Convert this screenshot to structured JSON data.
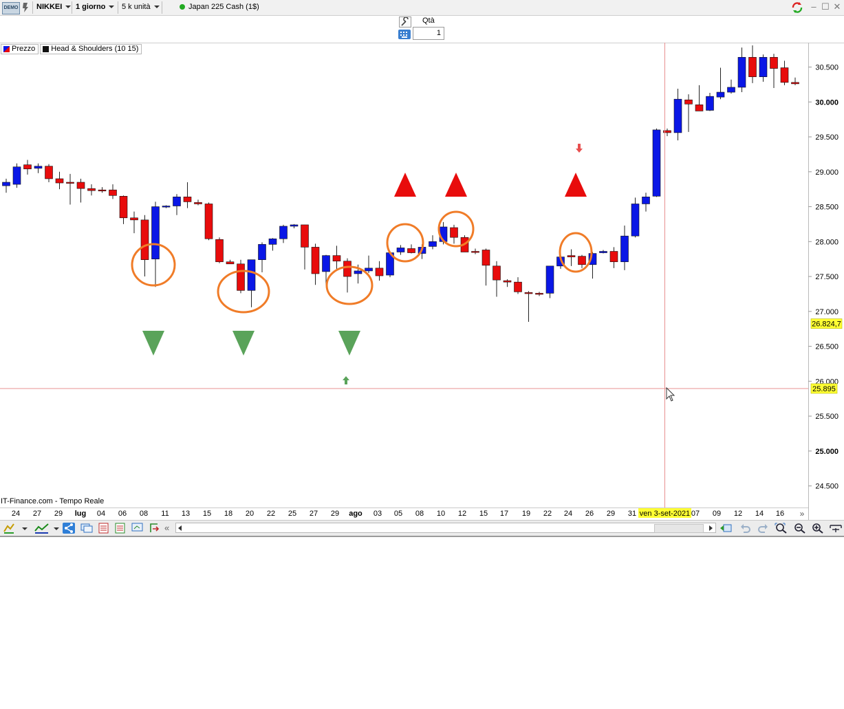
{
  "toolbar": {
    "demo_label": "DEMO",
    "instrument": "NIKKEI",
    "timeframe": "1 giorno",
    "units": "5 k unità",
    "market_name": "Japan 225 Cash (1$)",
    "status_color": "#22aa22"
  },
  "order": {
    "qty_label": "Qtà",
    "qty_value": "1"
  },
  "legend": {
    "price_label": "Prezzo",
    "indicator_label": "Head & Shoulders (10 15)"
  },
  "chart": {
    "source_label": "IT-Finance.com - Tempo Reale",
    "y_ticks": [
      "30.500",
      "30.000",
      "29.500",
      "29.000",
      "28.500",
      "28.000",
      "27.500",
      "27.000",
      "26.500",
      "26.000",
      "25.500",
      "25.000",
      "24.500"
    ],
    "y_tick_values": [
      30500,
      30000,
      29500,
      29000,
      28500,
      28000,
      27500,
      27000,
      26500,
      26000,
      25500,
      25000,
      24500
    ],
    "bold_ticks": [
      "30.000",
      "25.000"
    ],
    "x_labels": [
      "24",
      "27",
      "29",
      "lug",
      "04",
      "06",
      "08",
      "11",
      "13",
      "15",
      "18",
      "20",
      "22",
      "25",
      "27",
      "29",
      "ago",
      "03",
      "05",
      "08",
      "10",
      "12",
      "15",
      "17",
      "19",
      "22",
      "24",
      "26",
      "29",
      "31",
      "07",
      "09",
      "12",
      "14",
      "16"
    ],
    "current_price_label": "26.824,7",
    "current_price_value": 26824.7,
    "cursor_price_label": "25.895",
    "cursor_price_value": 25895,
    "cursor_date_label": "ven 3-set-2021",
    "up_color": "#0a17e6",
    "down_color": "#e80c0c",
    "circle_color": "#f07c28",
    "bull_marker_color": "#5aa35a",
    "bear_marker_color": "#e80c0c",
    "price_label_bg": "#ffff33"
  },
  "chart_data": {
    "type": "candlestick",
    "instrument": "NIKKEI",
    "timeframe": "1 giorno",
    "y_ticks": [
      24500,
      25000,
      25500,
      26000,
      26500,
      27000,
      27500,
      28000,
      28500,
      29000,
      29500,
      30000,
      30500
    ],
    "ylim": [
      24100,
      30900
    ],
    "x_tick_labels": [
      "24",
      "27",
      "29",
      "lug",
      "04",
      "06",
      "08",
      "11",
      "13",
      "15",
      "18",
      "20",
      "22",
      "25",
      "27",
      "29",
      "ago",
      "03",
      "05",
      "08",
      "10",
      "12",
      "15",
      "17",
      "19",
      "22",
      "24",
      "26",
      "29",
      "31",
      "07",
      "09",
      "12",
      "14",
      "16"
    ],
    "candles": [
      {
        "o": 28800,
        "h": 28900,
        "l": 28700,
        "c": 28850
      },
      {
        "o": 28820,
        "h": 29120,
        "l": 28770,
        "c": 29070
      },
      {
        "o": 29100,
        "h": 29170,
        "l": 28960,
        "c": 29040
      },
      {
        "o": 29050,
        "h": 29120,
        "l": 28980,
        "c": 29080
      },
      {
        "o": 29080,
        "h": 29110,
        "l": 28850,
        "c": 28900
      },
      {
        "o": 28900,
        "h": 29000,
        "l": 28750,
        "c": 28840
      },
      {
        "o": 28850,
        "h": 28970,
        "l": 28530,
        "c": 28840
      },
      {
        "o": 28850,
        "h": 28900,
        "l": 28560,
        "c": 28760
      },
      {
        "o": 28760,
        "h": 28820,
        "l": 28660,
        "c": 28730
      },
      {
        "o": 28740,
        "h": 28780,
        "l": 28700,
        "c": 28730
      },
      {
        "o": 28740,
        "h": 28820,
        "l": 28610,
        "c": 28660
      },
      {
        "o": 28650,
        "h": 28660,
        "l": 28250,
        "c": 28340
      },
      {
        "o": 28340,
        "h": 28430,
        "l": 28120,
        "c": 28310
      },
      {
        "o": 28310,
        "h": 28380,
        "l": 27500,
        "c": 27740
      },
      {
        "o": 27750,
        "h": 28570,
        "l": 27350,
        "c": 28500
      },
      {
        "o": 28500,
        "h": 28520,
        "l": 28480,
        "c": 28510
      },
      {
        "o": 28510,
        "h": 28680,
        "l": 28380,
        "c": 28640
      },
      {
        "o": 28640,
        "h": 28850,
        "l": 28480,
        "c": 28570
      },
      {
        "o": 28560,
        "h": 28600,
        "l": 28520,
        "c": 28540
      },
      {
        "o": 28540,
        "h": 28560,
        "l": 28020,
        "c": 28040
      },
      {
        "o": 28030,
        "h": 28060,
        "l": 27690,
        "c": 27710
      },
      {
        "o": 27710,
        "h": 27740,
        "l": 27690,
        "c": 27680
      },
      {
        "o": 27680,
        "h": 27740,
        "l": 27260,
        "c": 27300
      },
      {
        "o": 27300,
        "h": 27740,
        "l": 27060,
        "c": 27740
      },
      {
        "o": 27740,
        "h": 27990,
        "l": 27560,
        "c": 27960
      },
      {
        "o": 27960,
        "h": 28050,
        "l": 27870,
        "c": 28040
      },
      {
        "o": 28040,
        "h": 28240,
        "l": 27980,
        "c": 28220
      },
      {
        "o": 28220,
        "h": 28250,
        "l": 28190,
        "c": 28240
      },
      {
        "o": 28240,
        "h": 28240,
        "l": 27600,
        "c": 27920
      },
      {
        "o": 27920,
        "h": 27970,
        "l": 27380,
        "c": 27540
      },
      {
        "o": 27570,
        "h": 27810,
        "l": 27370,
        "c": 27800
      },
      {
        "o": 27800,
        "h": 27940,
        "l": 27590,
        "c": 27720
      },
      {
        "o": 27720,
        "h": 27760,
        "l": 27270,
        "c": 27500
      },
      {
        "o": 27540,
        "h": 27670,
        "l": 27400,
        "c": 27580
      },
      {
        "o": 27580,
        "h": 27800,
        "l": 27550,
        "c": 27620
      },
      {
        "o": 27620,
        "h": 27720,
        "l": 27440,
        "c": 27510
      },
      {
        "o": 27520,
        "h": 27840,
        "l": 27490,
        "c": 27840
      },
      {
        "o": 27850,
        "h": 27950,
        "l": 27810,
        "c": 27910
      },
      {
        "o": 27900,
        "h": 27960,
        "l": 27830,
        "c": 27840
      },
      {
        "o": 27830,
        "h": 27960,
        "l": 27750,
        "c": 27920
      },
      {
        "o": 27930,
        "h": 28090,
        "l": 27890,
        "c": 28000
      },
      {
        "o": 28000,
        "h": 28280,
        "l": 27960,
        "c": 28210
      },
      {
        "o": 28200,
        "h": 28240,
        "l": 27970,
        "c": 28060
      },
      {
        "o": 28060,
        "h": 28090,
        "l": 27860,
        "c": 27850
      },
      {
        "o": 27860,
        "h": 27900,
        "l": 27820,
        "c": 27850
      },
      {
        "o": 27880,
        "h": 27900,
        "l": 27370,
        "c": 27660
      },
      {
        "o": 27650,
        "h": 27720,
        "l": 27210,
        "c": 27450
      },
      {
        "o": 27440,
        "h": 27460,
        "l": 27350,
        "c": 27420
      },
      {
        "o": 27420,
        "h": 27490,
        "l": 27250,
        "c": 27280
      },
      {
        "o": 27270,
        "h": 27290,
        "l": 26850,
        "c": 27260
      },
      {
        "o": 27260,
        "h": 27280,
        "l": 27220,
        "c": 27250
      },
      {
        "o": 27260,
        "h": 27650,
        "l": 27190,
        "c": 27650
      },
      {
        "o": 27650,
        "h": 27800,
        "l": 27610,
        "c": 27780
      },
      {
        "o": 27800,
        "h": 27890,
        "l": 27650,
        "c": 27780
      },
      {
        "o": 27790,
        "h": 27810,
        "l": 27620,
        "c": 27670
      },
      {
        "o": 27670,
        "h": 27850,
        "l": 27470,
        "c": 27830
      },
      {
        "o": 27840,
        "h": 27880,
        "l": 27830,
        "c": 27860
      },
      {
        "o": 27860,
        "h": 27920,
        "l": 27620,
        "c": 27710
      },
      {
        "o": 27710,
        "h": 28230,
        "l": 27590,
        "c": 28080
      },
      {
        "o": 28080,
        "h": 28630,
        "l": 28060,
        "c": 28540
      },
      {
        "o": 28540,
        "h": 28700,
        "l": 28430,
        "c": 28640
      },
      {
        "o": 28650,
        "h": 29620,
        "l": 28640,
        "c": 29600
      },
      {
        "o": 29590,
        "h": 29620,
        "l": 29510,
        "c": 29560
      },
      {
        "o": 29560,
        "h": 30190,
        "l": 29450,
        "c": 30040
      },
      {
        "o": 30030,
        "h": 30110,
        "l": 29570,
        "c": 29970
      },
      {
        "o": 29960,
        "h": 30240,
        "l": 29870,
        "c": 29870
      },
      {
        "o": 29880,
        "h": 30130,
        "l": 29870,
        "c": 30080
      },
      {
        "o": 30070,
        "h": 30490,
        "l": 30040,
        "c": 30140
      },
      {
        "o": 30140,
        "h": 30320,
        "l": 30120,
        "c": 30210
      },
      {
        "o": 30210,
        "h": 30780,
        "l": 30140,
        "c": 30640
      },
      {
        "o": 30640,
        "h": 30810,
        "l": 30270,
        "c": 30360
      },
      {
        "o": 30360,
        "h": 30680,
        "l": 30290,
        "c": 30640
      },
      {
        "o": 30640,
        "h": 30690,
        "l": 30200,
        "c": 30480
      },
      {
        "o": 30490,
        "h": 30590,
        "l": 30240,
        "c": 30280
      },
      {
        "o": 30280,
        "h": 30350,
        "l": 30240,
        "c": 30260
      }
    ],
    "pattern_markers": [
      {
        "type": "bull",
        "index": 13,
        "shape": "triangle-down",
        "circled": true
      },
      {
        "type": "bull",
        "index": 21,
        "shape": "triangle-down",
        "circled": true
      },
      {
        "type": "bull",
        "index": 32,
        "shape": "triangle-down",
        "circled": true
      },
      {
        "type": "bear",
        "index": 38,
        "shape": "triangle-up",
        "circled": true
      },
      {
        "type": "bear",
        "index": 43,
        "shape": "triangle-up",
        "circled": true
      },
      {
        "type": "bear",
        "index": 55,
        "shape": "triangle-up",
        "circled": true
      }
    ],
    "arrows": [
      {
        "type": "up",
        "index": 32
      },
      {
        "type": "down",
        "index": 55
      }
    ],
    "current_price": 26824.7,
    "cursor_price": 25895
  }
}
